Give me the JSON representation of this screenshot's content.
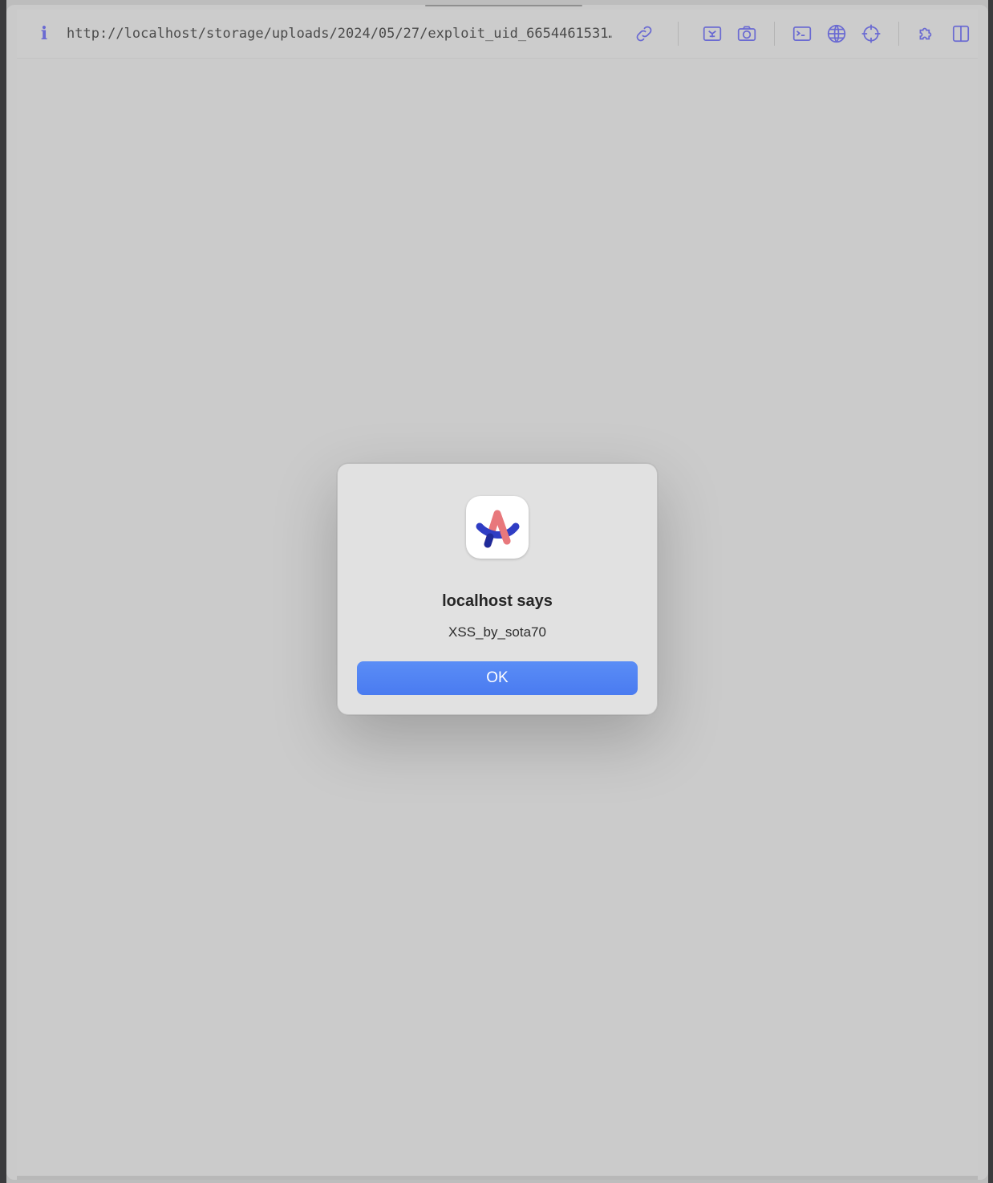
{
  "browser": {
    "url": "http://localhost/storage/uploads/2024/05/27/exploit_uid_6654461531…",
    "info_icon": "info-icon",
    "toolbar_icons": [
      "link-icon",
      "screenshot-region-icon",
      "camera-icon",
      "terminal-icon",
      "globe-icon",
      "crosshair-icon",
      "extensions-icon",
      "split-view-icon"
    ],
    "accent_color": "#6a6ad2"
  },
  "dialog": {
    "app_icon": "arc-browser-icon",
    "title": "localhost says",
    "message": "XSS_by_sota70",
    "ok_label": "OK",
    "button_color": "#4f82f3"
  }
}
